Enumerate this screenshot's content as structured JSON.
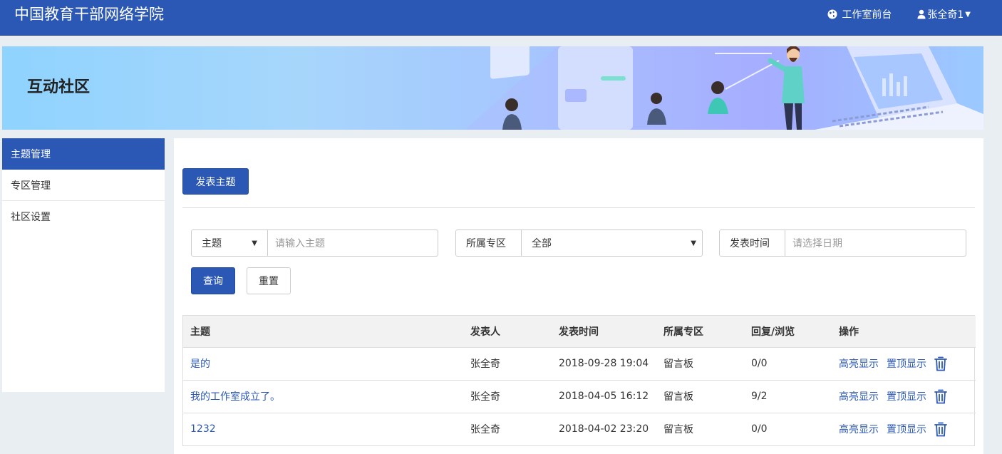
{
  "header": {
    "site_title": "中国教育干部网络学院",
    "studio_front_label": "工作室前台",
    "user_label": "张全奇1",
    "accent_color": "#2b58b4"
  },
  "banner": {
    "title": "互动社区"
  },
  "sidebar": {
    "items": [
      {
        "label": "主题管理",
        "active": true
      },
      {
        "label": "专区管理",
        "active": false
      },
      {
        "label": "社区设置",
        "active": false
      }
    ]
  },
  "toolbar": {
    "post_label": "发表主题"
  },
  "filters": {
    "topic_type": "主题",
    "topic_placeholder": "请输入主题",
    "zone_label": "所属专区",
    "zone_value": "全部",
    "time_label": "发表时间",
    "date_placeholder": "请选择日期",
    "query_label": "查询",
    "reset_label": "重置"
  },
  "table": {
    "columns": [
      "主题",
      "发表人",
      "发表时间",
      "所属专区",
      "回复/浏览",
      "操作"
    ],
    "highlight_label": "高亮显示",
    "pin_label": "置顶显示",
    "delete_icon": "trash-icon",
    "rows": [
      {
        "topic": "是的",
        "author": "张全奇",
        "time": "2018-09-28 19:04",
        "zone": "留言板",
        "stats": "0/0"
      },
      {
        "topic": "我的工作室成立了。",
        "author": "张全奇",
        "time": "2018-04-05 16:12",
        "zone": "留言板",
        "stats": "9/2"
      },
      {
        "topic": "1232",
        "author": "张全奇",
        "time": "2018-04-02 23:20",
        "zone": "留言板",
        "stats": "0/0"
      }
    ]
  }
}
